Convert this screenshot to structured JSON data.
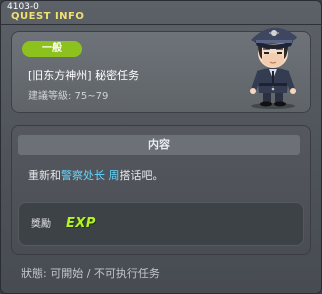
{
  "header": {
    "quest_id": "4103-0",
    "title": "QUEST INFO"
  },
  "quest": {
    "category": "一般",
    "name": "[旧东方神州] 秘密任务",
    "level_range": "建議等級: 75~79"
  },
  "content": {
    "header": "内容",
    "desc_prefix": "重新和",
    "desc_npc": "警察处长 周",
    "desc_suffix": "搭话吧。"
  },
  "reward": {
    "label": "獎勵",
    "type": "EXP"
  },
  "status": {
    "text": "狀態:  可開始 / 不可执行任务"
  },
  "colors": {
    "badge": "#8dc11e",
    "title": "#f0e070",
    "npc_highlight": "#62d6ff",
    "exp": "#b7f22a"
  }
}
